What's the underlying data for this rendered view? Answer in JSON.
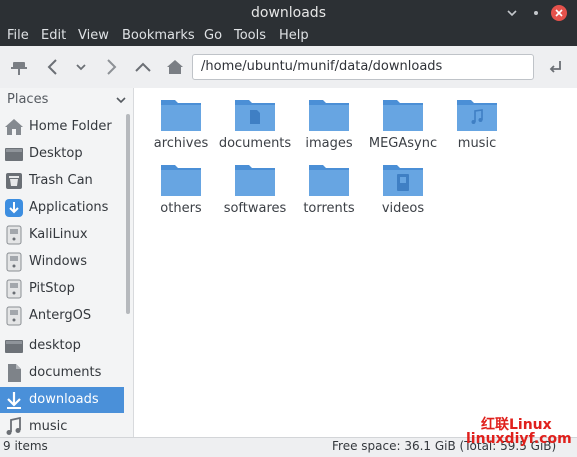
{
  "window": {
    "title": "downloads",
    "controls": [
      "chevron-down-icon",
      "maximize-icon",
      "close-icon"
    ]
  },
  "menu": [
    "File",
    "Edit",
    "View",
    "Bookmarks",
    "Go",
    "Tools",
    "Help"
  ],
  "toolbar": {
    "path": "/home/ubuntu/munif/data/downloads"
  },
  "sidebar": {
    "header": "Places",
    "items": [
      {
        "label": "Home Folder",
        "icon": "home-folder-icon"
      },
      {
        "label": "Desktop",
        "icon": "desktop-icon"
      },
      {
        "label": "Trash Can",
        "icon": "trash-icon"
      },
      {
        "label": "Applications",
        "icon": "applications-icon"
      },
      {
        "label": "KaliLinux",
        "icon": "drive-icon"
      },
      {
        "label": "Windows",
        "icon": "drive-icon"
      },
      {
        "label": "PitStop",
        "icon": "drive-icon"
      },
      {
        "label": "AntergOS",
        "icon": "drive-icon"
      },
      {
        "label": "desktop",
        "icon": "desktop-icon"
      },
      {
        "label": "documents",
        "icon": "document-icon"
      },
      {
        "label": "downloads",
        "icon": "downloads-icon",
        "active": true
      },
      {
        "label": "music",
        "icon": "music-icon"
      }
    ]
  },
  "files": [
    {
      "name": "archives",
      "icon": "folder-icon"
    },
    {
      "name": "documents",
      "icon": "folder-documents-icon"
    },
    {
      "name": "images",
      "icon": "folder-icon"
    },
    {
      "name": "MEGAsync",
      "icon": "folder-icon"
    },
    {
      "name": "music",
      "icon": "folder-music-icon"
    },
    {
      "name": "others",
      "icon": "folder-icon"
    },
    {
      "name": "softwares",
      "icon": "folder-icon"
    },
    {
      "name": "torrents",
      "icon": "folder-icon"
    },
    {
      "name": "videos",
      "icon": "folder-videos-icon"
    }
  ],
  "status": {
    "items": "9 items",
    "free_space": "Free space: 36.1 GiB (Total: 59.5 GiB)"
  },
  "watermark": {
    "line1": "红联Linux",
    "line2": "linuxdiyf.com"
  },
  "colors": {
    "titlebar": "#2c3034",
    "accent": "#4a90d9",
    "folder": "#5fa0dc",
    "watermark": "#e0201c"
  }
}
